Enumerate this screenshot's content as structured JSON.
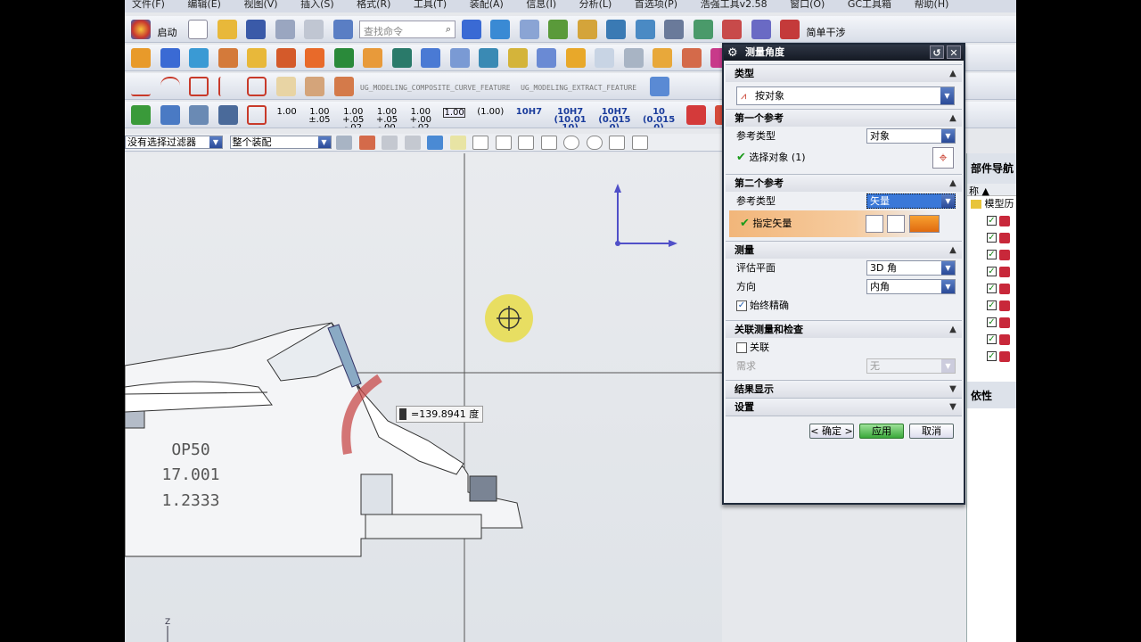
{
  "menubar": [
    "文件(F)",
    "编辑(E)",
    "视图(V)",
    "插入(S)",
    "格式(R)",
    "工具(T)",
    "装配(A)",
    "信息(I)",
    "分析(L)",
    "首选项(P)",
    "浩强工具v2.58",
    "窗口(O)",
    "GC工具箱",
    "帮助(H)"
  ],
  "toolbar1": {
    "start_label": "启动",
    "search_placeholder": "查找命令",
    "simple_interference": "简单干涉"
  },
  "toolbar3": {
    "feature1": "UG_MODELING_COMPOSITE_CURVE_FEATURE",
    "feature2": "UG_MODELING_EXTRACT_FEATURE"
  },
  "toolbar4": {
    "dims": [
      "1.00",
      "1.00\n±.05",
      "1.00\n+.05\n-.02",
      "1.00\n+.05\n-.00",
      "1.00\n+.00\n-.02",
      "1.00",
      "(1.00)",
      "10H7",
      "10H7\n(10.01\n10)",
      "10H7\n(0.015\n0)",
      "10\n(0.015\n0)"
    ]
  },
  "filterbar": {
    "filter": "没有选择过滤器",
    "scope": "整个装配"
  },
  "viewport": {
    "measure_readout": "=139.8941 度",
    "annotation_lines": [
      "OP50",
      "17.001",
      "1.2333"
    ],
    "axis_z": "Z"
  },
  "right_panel": {
    "title": "部件导航",
    "column": "称",
    "root": "模型历",
    "rows_count": 9,
    "dependents": "依性"
  },
  "dialog": {
    "title": "测量角度",
    "type_section": "类型",
    "type_value": "按对象",
    "ref1_section": "第一个参考",
    "ref1_type_label": "参考类型",
    "ref1_type_value": "对象",
    "ref1_select_label": "选择对象 (1)",
    "ref2_section": "第二个参考",
    "ref2_type_label": "参考类型",
    "ref2_type_value": "矢量",
    "ref2_vector_label": "指定矢量",
    "measure_section": "测量",
    "eval_plane_label": "评估平面",
    "eval_plane_value": "3D 角",
    "direction_label": "方向",
    "direction_value": "内角",
    "always_accurate_label": "始终精确",
    "associative_section": "关联测量和检查",
    "associative_label": "关联",
    "require_label": "需求",
    "require_value": "无",
    "results_section": "结果显示",
    "settings_section": "设置",
    "ok_label": "< 确定 >",
    "apply_label": "应用",
    "cancel_label": "取消"
  }
}
